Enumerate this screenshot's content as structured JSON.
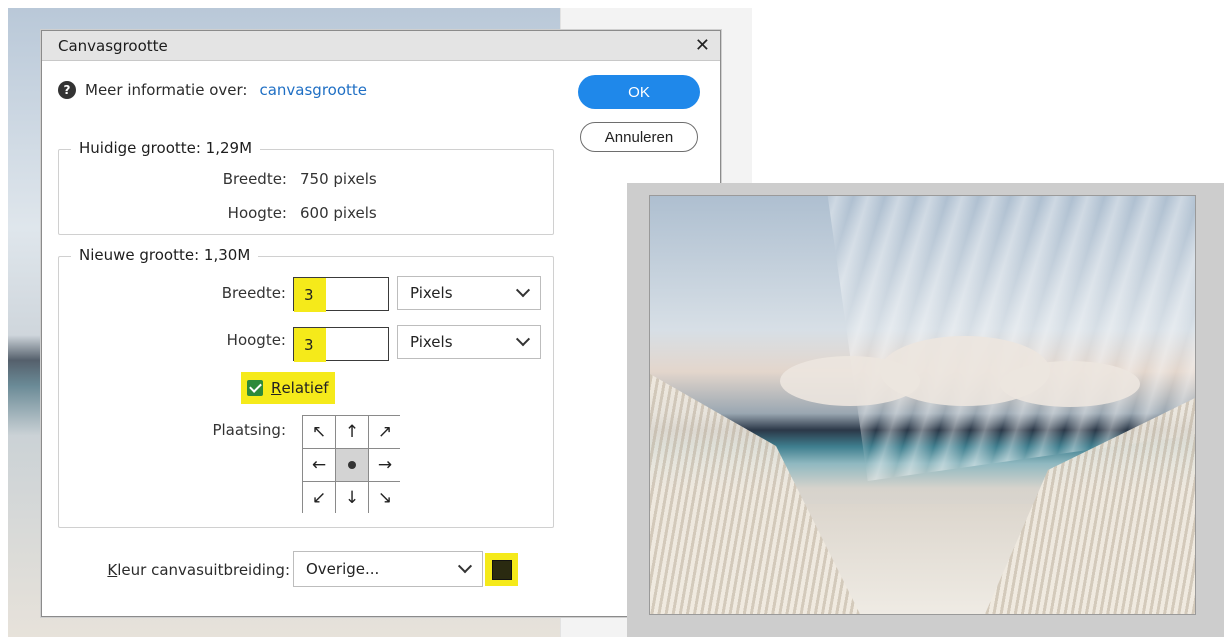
{
  "dialog": {
    "title": "Canvasgrootte",
    "close_glyph": "✕",
    "info_label": "Meer informatie over:",
    "info_link": "canvasgrootte",
    "ok_label": "OK",
    "cancel_label": "Annuleren"
  },
  "current_size": {
    "legend": "Huidige grootte: 1,29M",
    "width_label": "Breedte:",
    "width_value": "750 pixels",
    "height_label": "Hoogte:",
    "height_value": "600 pixels"
  },
  "new_size": {
    "legend": "Nieuwe grootte: 1,30M",
    "width_label": "Breedte:",
    "width_value": "3",
    "width_unit": "Pixels",
    "height_label": "Hoogte:",
    "height_value": "3",
    "height_unit": "Pixels",
    "relative_label_first": "R",
    "relative_label_rest": "elatief",
    "relative_checked": true,
    "anchor_label": "Plaatsing:",
    "anchor_cells": [
      "↖",
      "↑",
      "↗",
      "←",
      "",
      "→",
      "↙",
      "↓",
      "↘"
    ]
  },
  "extension_color": {
    "label_first": "K",
    "label_rest": "leur canvasuitbreiding:",
    "selected": "Overige...",
    "swatch_color": "#2a2a10"
  },
  "highlight_color": "#f5ea1a",
  "accent_color": "#1f88ea"
}
